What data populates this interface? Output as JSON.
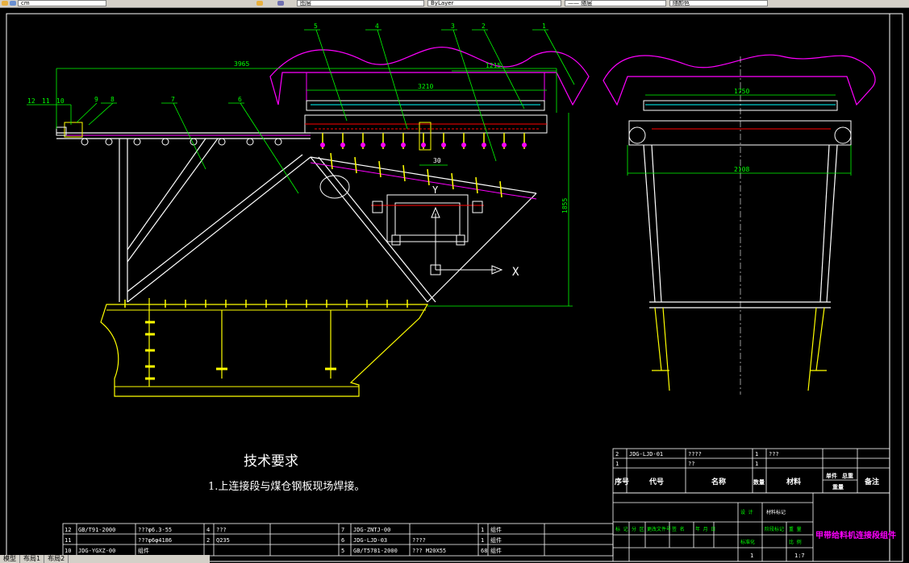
{
  "toolbar": {
    "field_1": "cm",
    "field_2": "图层",
    "field_3": "ByLayer",
    "field_4": "—— 随层",
    "field_5": "随颜色"
  },
  "balloons": {
    "b1": "1",
    "b2": "2",
    "b3": "3",
    "b4": "4",
    "b5": "5",
    "b6": "6",
    "b7": "7",
    "b8": "8",
    "b9": "9",
    "b10": "10",
    "b11": "11",
    "b12": "12"
  },
  "dims": {
    "total_length": "3965",
    "top_right": "1215",
    "inner_width": "3210",
    "height": "1855",
    "small": "30",
    "side_top": "1750",
    "side_bottom": "2108"
  },
  "axis": {
    "x": "X",
    "y": "Y"
  },
  "notes": {
    "title": "技术要求",
    "line1": "1.上连接段与煤仓钢板现场焊接。"
  },
  "bom_right": {
    "rows": [
      {
        "no": "2",
        "code": "JDG-LJD-01",
        "name": "????",
        "qty": "1",
        "material": "???"
      },
      {
        "no": "1",
        "code": "",
        "name": "??",
        "qty": "1",
        "material": ""
      }
    ],
    "header": {
      "no": "序号",
      "code": "代号",
      "name": "名称",
      "qty": "数量",
      "material": "材料",
      "unit_weight": "单件",
      "total_weight": "总重",
      "weight": "重量",
      "remark": "备注"
    }
  },
  "bom_left": {
    "rows": [
      {
        "no": "12",
        "code": "GB/T91-2000",
        "name": "???φ6.3-55",
        "qty": "4",
        "material": "???",
        "no2": "7",
        "code2": "JDG-ZNTJ-00",
        "name2": "",
        "qty2": "1",
        "mat2": "组件"
      },
      {
        "no": "11",
        "code": "",
        "name": "???φ6φ4186",
        "qty": "2",
        "material": "Q235",
        "no2": "6",
        "code2": "JDG-LJD-03",
        "name2": "????",
        "qty2": "1",
        "mat2": "组件"
      },
      {
        "no": "10",
        "code": "JDG-YGXZ-00",
        "name": "组件",
        "qty": "",
        "material": "",
        "no2": "5",
        "code2": "GB/T5781-2000",
        "name2": "??? M20X55",
        "qty2": "68",
        "mat2": "组件"
      }
    ]
  },
  "title_block": {
    "drawing_title": "甲带给料机连接段组件",
    "label_mark": "标 记",
    "label_zones": "分 区",
    "label_changes": "更改文件号",
    "label_sign": "签 名",
    "label_date": "年 月 日",
    "label_stage": "阶段标记",
    "label_weight": "重 量",
    "label_scale": "比 例",
    "label_design": "设 计",
    "label_standard": "标准化",
    "label_mat_mark": "材料标记",
    "scale": "1:7",
    "sheet": "1",
    "label_qty": "共",
    "label_sheet": "第"
  },
  "tabs": {
    "model": "模型",
    "layout1": "布局1",
    "layout2": "布局2"
  },
  "colors": {
    "magenta": "#ff00ff",
    "yellow": "#ffff00",
    "green": "#00ff00",
    "cyan": "#00ffff",
    "red": "#ff0000",
    "white": "#ffffff"
  }
}
